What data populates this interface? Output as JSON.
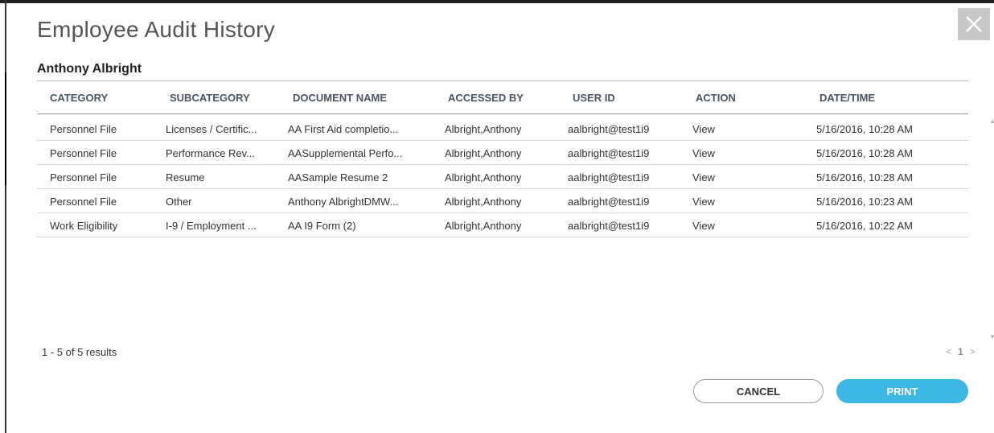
{
  "dialog": {
    "title": "Employee Audit History",
    "employee_name": "Anthony Albright",
    "close_icon": "close-icon"
  },
  "table": {
    "columns": [
      "CATEGORY",
      "SUBCATEGORY",
      "DOCUMENT NAME",
      "ACCESSED BY",
      "USER ID",
      "ACTION",
      "DATE/TIME"
    ],
    "rows": [
      [
        "Personnel File",
        "Licenses / Certific...",
        "AA First Aid completio...",
        "Albright,Anthony",
        "aalbright@test1i9",
        "View",
        "5/16/2016, 10:28 AM"
      ],
      [
        "Personnel File",
        "Performance Rev...",
        "AASupplemental Perfo...",
        "Albright,Anthony",
        "aalbright@test1i9",
        "View",
        "5/16/2016, 10:28 AM"
      ],
      [
        "Personnel File",
        "Resume",
        "AASample Resume 2",
        "Albright,Anthony",
        "aalbright@test1i9",
        "View",
        "5/16/2016, 10:28 AM"
      ],
      [
        "Personnel File",
        "Other",
        "Anthony AlbrightDMW...",
        "Albright,Anthony",
        "aalbright@test1i9",
        "View",
        "5/16/2016, 10:23 AM"
      ],
      [
        "Work Eligibility",
        "I-9 / Employment ...",
        "AA I9 Form (2)",
        "Albright,Anthony",
        "aalbright@test1i9",
        "View",
        "5/16/2016, 10:22 AM"
      ]
    ]
  },
  "footer": {
    "results_text": "1 - 5 of 5 results",
    "pager_prev": "<",
    "pager_current": "1",
    "pager_next": ">"
  },
  "buttons": {
    "cancel_label": "CANCEL",
    "print_label": "PRINT"
  },
  "colors": {
    "accent": "#3db8e5",
    "close_bg": "#c8c8c8"
  }
}
